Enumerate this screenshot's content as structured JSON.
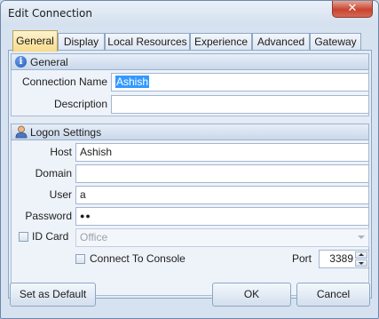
{
  "window": {
    "title": "Edit Connection",
    "close_glyph": "✕"
  },
  "tabs": [
    {
      "label": "General",
      "active": true
    },
    {
      "label": "Display"
    },
    {
      "label": "Local Resources"
    },
    {
      "label": "Experience"
    },
    {
      "label": "Advanced"
    },
    {
      "label": "Gateway"
    }
  ],
  "general": {
    "header": "General",
    "header_icon": "info-icon",
    "connection_name_label": "Connection Name",
    "connection_name_value": "Ashish",
    "description_label": "Description",
    "description_value": ""
  },
  "logon": {
    "header": "Logon Settings",
    "header_icon": "user-icon",
    "host_label": "Host",
    "host_value": "Ashish",
    "domain_label": "Domain",
    "domain_value": "",
    "user_label": "User",
    "user_value": "a",
    "password_label": "Password",
    "password_value": "●●",
    "id_card_label": "ID Card",
    "id_card_checked": false,
    "id_card_value": "Office",
    "connect_console_label": "Connect To Console",
    "connect_console_checked": false,
    "port_label": "Port",
    "port_value": "3389"
  },
  "buttons": {
    "set_default": "Set as Default",
    "ok": "OK",
    "cancel": "Cancel"
  },
  "colors": {
    "selection": "#3399ff",
    "active_tab": "#f8dc8a",
    "close_button": "#c8442f"
  }
}
